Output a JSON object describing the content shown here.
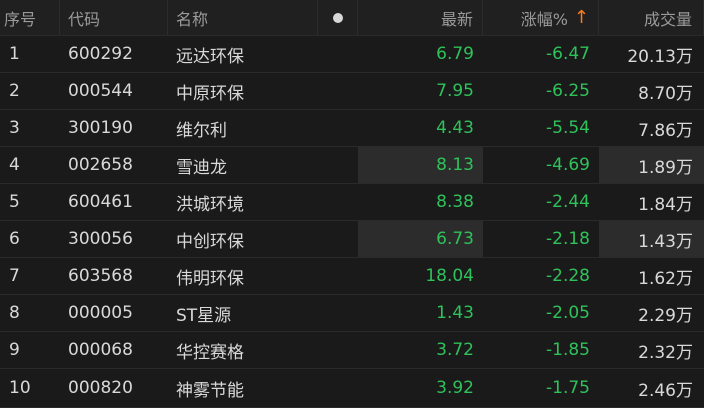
{
  "header": {
    "seq": "序号",
    "code": "代码",
    "name": "名称",
    "price": "最新",
    "change": "涨幅%",
    "change_sort_arrow": "↑",
    "volume": "成交量"
  },
  "rows": [
    {
      "seq": "1",
      "code": "600292",
      "name": "远达环保",
      "price": "6.79",
      "change": "-6.47",
      "volume": "20.13万"
    },
    {
      "seq": "2",
      "code": "000544",
      "name": "中原环保",
      "price": "7.95",
      "change": "-6.25",
      "volume": "8.70万"
    },
    {
      "seq": "3",
      "code": "300190",
      "name": "维尔利",
      "price": "4.43",
      "change": "-5.54",
      "volume": "7.86万"
    },
    {
      "seq": "4",
      "code": "002658",
      "name": "雪迪龙",
      "price": "8.13",
      "change": "-4.69",
      "volume": "1.89万"
    },
    {
      "seq": "5",
      "code": "600461",
      "name": "洪城环境",
      "price": "8.38",
      "change": "-2.44",
      "volume": "1.84万"
    },
    {
      "seq": "6",
      "code": "300056",
      "name": "中创环保",
      "price": "6.73",
      "change": "-2.18",
      "volume": "1.43万"
    },
    {
      "seq": "7",
      "code": "603568",
      "name": "伟明环保",
      "price": "18.04",
      "change": "-2.28",
      "volume": "1.62万"
    },
    {
      "seq": "8",
      "code": "000005",
      "name": "ST星源",
      "price": "1.43",
      "change": "-2.05",
      "volume": "2.29万"
    },
    {
      "seq": "9",
      "code": "000068",
      "name": "华控赛格",
      "price": "3.72",
      "change": "-1.85",
      "volume": "2.32万"
    },
    {
      "seq": "10",
      "code": "000820",
      "name": "神雾节能",
      "price": "3.92",
      "change": "-1.75",
      "volume": "2.46万"
    }
  ],
  "colors": {
    "background": "#1a1a1a",
    "header_background": "#202020",
    "down": "#2fc25b",
    "sort_arrow": "#ff7a1a",
    "highlight": "#2c2c2c"
  }
}
